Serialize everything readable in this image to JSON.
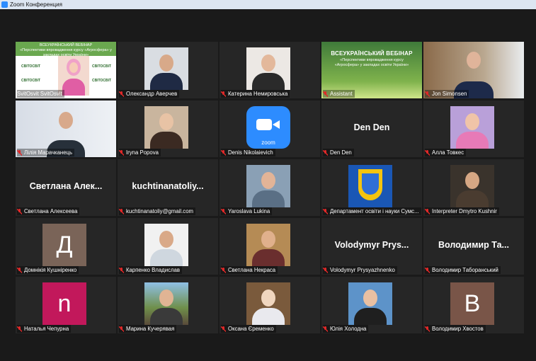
{
  "window": {
    "title": "Zoom Конференция"
  },
  "colors": {
    "background": "#1a1a1a",
    "tile": "#262626",
    "active_border": "#c7e44a",
    "muted_mic": "#e02828",
    "zoom_blue": "#2d8cff"
  },
  "active_speaker": {
    "slide_title": "ВСЕУКРАЇНСЬКИЙ ВЕБІНАР",
    "slide_subtitle": "«Перспективи впровадження курсу «Агросфера» у закладах освіти України»",
    "logo_text": "СВІТОСВІТ"
  },
  "assistant_banner": {
    "title": "ВСЕУКРАЇНСЬКИЙ ВЕБІНАР",
    "subtitle": "«Перспективи впровадження курсу «Агросфера» у закладах освіти України»"
  },
  "zoom_logo_text": "zoom",
  "participants": [
    {
      "name": "SvitOsvit SvitOsvit",
      "muted": false
    },
    {
      "name": "Олександр Аверчев",
      "muted": true
    },
    {
      "name": "Катерина Немировська",
      "muted": true
    },
    {
      "name": "Assistant",
      "muted": true
    },
    {
      "name": "Jon Simonsen",
      "muted": true
    },
    {
      "name": "Лілія Марачканець",
      "muted": true
    },
    {
      "name": "Iryna Popova",
      "muted": true
    },
    {
      "name": "Denis Nikolaievich",
      "muted": true
    },
    {
      "name": "Den Den",
      "muted": true,
      "display": "Den Den"
    },
    {
      "name": "Алла Товкес",
      "muted": true
    },
    {
      "name": "Светлана Алексеева",
      "muted": true,
      "display": "Светлана Алек..."
    },
    {
      "name": "kuchtinanatoliy@gmail.com",
      "muted": true,
      "display": "kuchtinanatoliy..."
    },
    {
      "name": "Yaroslava Lukina",
      "muted": true
    },
    {
      "name": "Департамент освіти і науки Сумс...",
      "muted": true
    },
    {
      "name": "Interpreter Dmytro Kushnir",
      "muted": true
    },
    {
      "name": "Домнікія Кушніренко",
      "muted": true,
      "avatar_letter": "Д"
    },
    {
      "name": "Карпенко Владислав",
      "muted": true
    },
    {
      "name": "Светлана Некраса",
      "muted": true
    },
    {
      "name": "Volodymyr Prysyazhnenko",
      "muted": true,
      "display": "Volodymyr Prys..."
    },
    {
      "name": "Володимир Таборанський",
      "muted": true,
      "display": "Володимир Та..."
    },
    {
      "name": "Наталья Чепурна",
      "muted": true,
      "avatar_letter": "n"
    },
    {
      "name": "Марина Кучерявая",
      "muted": true
    },
    {
      "name": "Оксана Єременко",
      "muted": true
    },
    {
      "name": "Юлія Холодна",
      "muted": true
    },
    {
      "name": "Володимир Хвостов",
      "muted": true,
      "avatar_letter": "B"
    }
  ]
}
